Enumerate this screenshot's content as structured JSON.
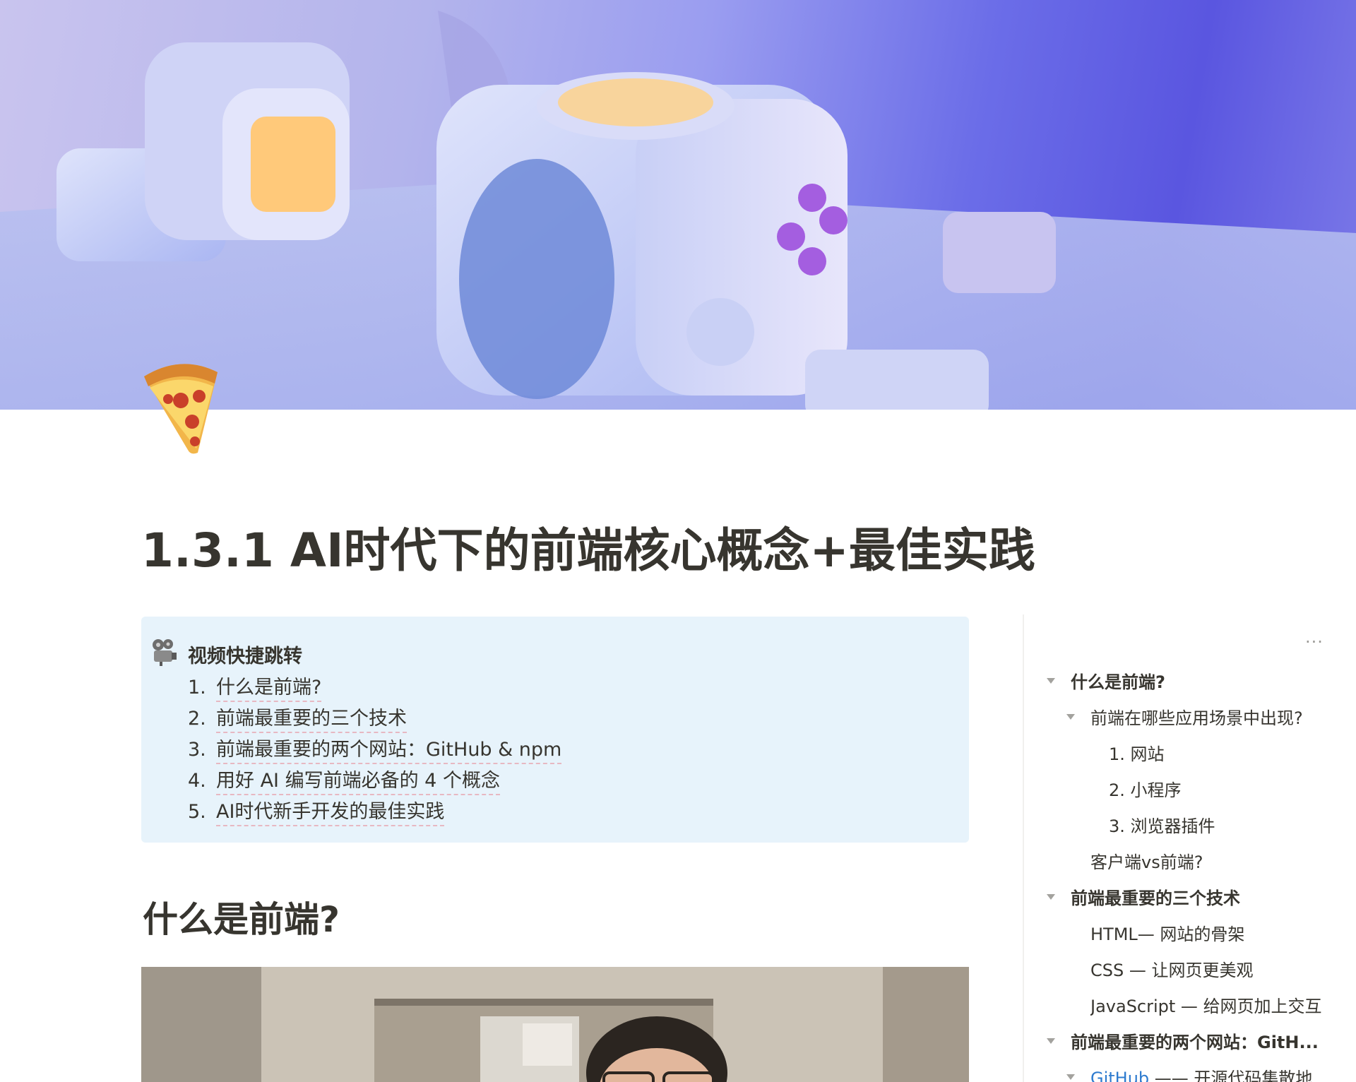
{
  "page": {
    "icon": "pizza-icon",
    "title": "1.3.1 AI时代下的前端核心概念+最佳实践"
  },
  "callout": {
    "icon": "film-projector-icon",
    "heading": "视频快捷跳转",
    "items": [
      {
        "num": "1.",
        "text": "什么是前端?"
      },
      {
        "num": "2.",
        "text": "前端最重要的三个技术"
      },
      {
        "num": "3.",
        "text": "前端最重要的两个网站：GitHub & npm"
      },
      {
        "num": "4.",
        "text": "用好 AI 编写前端必备的 4 个概念"
      },
      {
        "num": "5.",
        "text": "AI时代新手开发的最佳实践"
      }
    ]
  },
  "section": {
    "heading": "什么是前端?"
  },
  "toc": {
    "more_label": "...",
    "items": [
      {
        "text": "什么是前端?",
        "level": 0,
        "caret": true,
        "bold": true
      },
      {
        "text": "前端在哪些应用场景中出现?",
        "level": 1,
        "caret": true,
        "bold": false
      },
      {
        "text": "1. 网站",
        "level": 2,
        "caret": false,
        "bold": false
      },
      {
        "text": "2. 小程序",
        "level": 2,
        "caret": false,
        "bold": false
      },
      {
        "text": "3. 浏览器插件",
        "level": 2,
        "caret": false,
        "bold": false
      },
      {
        "text": "客户端vs前端?",
        "level": 1,
        "caret": false,
        "bold": false
      },
      {
        "text": "前端最重要的三个技术",
        "level": 0,
        "caret": true,
        "bold": true
      },
      {
        "text": "HTML— 网站的骨架",
        "level": 1,
        "caret": false,
        "bold": false
      },
      {
        "text": "CSS — 让网页更美观",
        "level": 1,
        "caret": false,
        "bold": false
      },
      {
        "text": "JavaScript — 给网页加上交互",
        "level": 1,
        "caret": false,
        "bold": false
      },
      {
        "text": "前端最重要的两个网站：GitH...",
        "level": 0,
        "caret": true,
        "bold": true
      },
      {
        "text": "GitHub",
        "suffix": " —— 开源代码集散地",
        "level": 1,
        "caret": true,
        "bold": false,
        "link": true
      }
    ]
  },
  "colors": {
    "callout_bg": "#e7f3fb",
    "text": "#37352f",
    "link": "#2e7bcf",
    "muted": "#9b9a97"
  }
}
